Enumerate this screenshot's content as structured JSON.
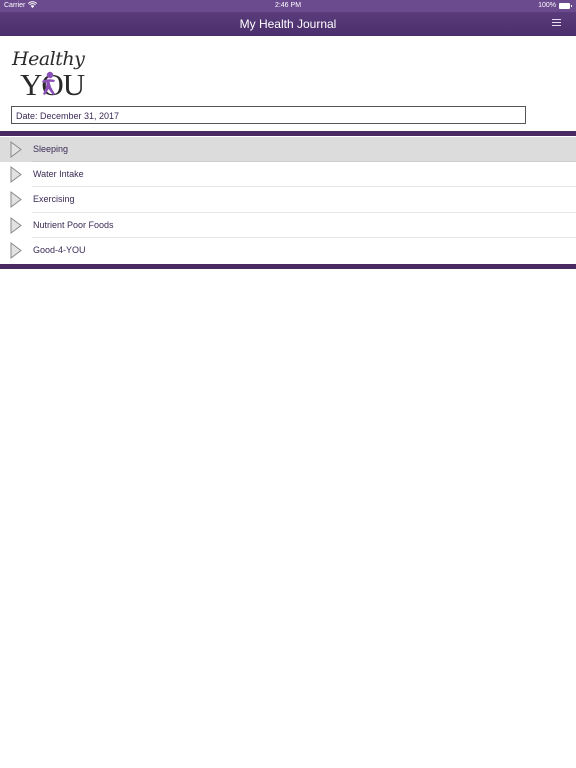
{
  "status_bar": {
    "carrier": "Carrier",
    "time": "2:46 PM",
    "battery": "100%"
  },
  "nav_bar": {
    "title": "My Health Journal",
    "menu_icon": "hamburger-menu-icon"
  },
  "logo": {
    "line1": "Healthy",
    "line2": "YOU"
  },
  "date_field": {
    "value": "Date: December 31, 2017"
  },
  "journal_items": [
    {
      "label": "Sleeping",
      "icon": "triangle-arrow-icon",
      "selected": true
    },
    {
      "label": "Water Intake",
      "icon": "triangle-arrow-icon",
      "selected": false
    },
    {
      "label": "Exercising",
      "icon": "triangle-arrow-icon",
      "selected": false
    },
    {
      "label": "Nutrient Poor Foods",
      "icon": "triangle-arrow-icon",
      "selected": false
    },
    {
      "label": "Good-4-YOU",
      "icon": "triangle-arrow-icon",
      "selected": false
    }
  ],
  "colors": {
    "brand_purple": "#4a2e6a",
    "band_purple": "#4a2a63",
    "text_purple": "#3a2a55",
    "selected_row": "#dcdcdc"
  }
}
